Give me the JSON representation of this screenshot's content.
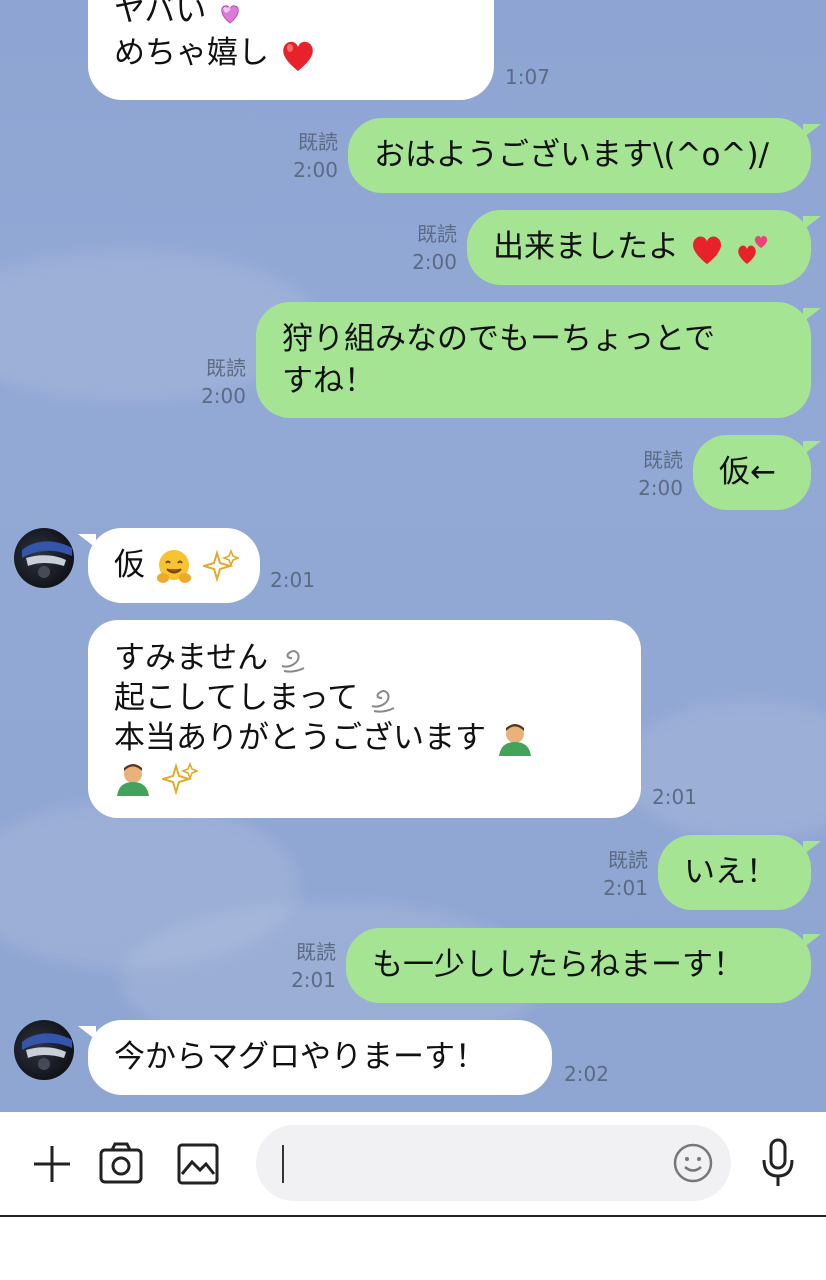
{
  "messages": [
    {
      "side": "in",
      "lines": [
        "ヤバい",
        "めちゃ嬉し"
      ],
      "emoji": [
        "revolving-hearts",
        "red-heart"
      ],
      "time": "1:07"
    },
    {
      "side": "out",
      "text": "おはようございます\\(^o^)/",
      "read": "既読",
      "time": "2:00"
    },
    {
      "side": "out",
      "text": "出来ましたよ",
      "emoji": [
        "red-heart",
        "two-hearts"
      ],
      "read": "既読",
      "time": "2:00"
    },
    {
      "side": "out",
      "lines": [
        "狩り組みなのでもーちょっとで",
        "すね！"
      ],
      "read": "既読",
      "time": "2:00"
    },
    {
      "side": "out",
      "text": "仮←",
      "read": "既読",
      "time": "2:00"
    },
    {
      "side": "in",
      "text": "仮",
      "emoji": [
        "hugging-face",
        "sparkles"
      ],
      "time": "2:01"
    },
    {
      "side": "in",
      "lines": [
        "すみません",
        "起こしてしまって",
        "本当ありがとうございます"
      ],
      "emoji": [
        "dash",
        "dash",
        "person-bowing",
        "person-bowing",
        "sparkles"
      ],
      "time": "2:01"
    },
    {
      "side": "out",
      "text": "いえ！",
      "read": "既読",
      "time": "2:01"
    },
    {
      "side": "out",
      "text": "も一少ししたらねまーす！",
      "read": "既読",
      "time": "2:01"
    },
    {
      "side": "in",
      "text": "今からマグロやりまーす！",
      "time": "2:02"
    }
  ],
  "input": {
    "value": "",
    "placeholder": ""
  },
  "toolbar": {
    "icons": [
      "plus-icon",
      "camera-icon",
      "image-icon",
      "emoji-icon",
      "microphone-icon"
    ]
  },
  "colors": {
    "chat_bg": "#8fa5d2",
    "outgoing": "#a5e493",
    "incoming": "#ffffff",
    "meta": "#5c6b84"
  }
}
